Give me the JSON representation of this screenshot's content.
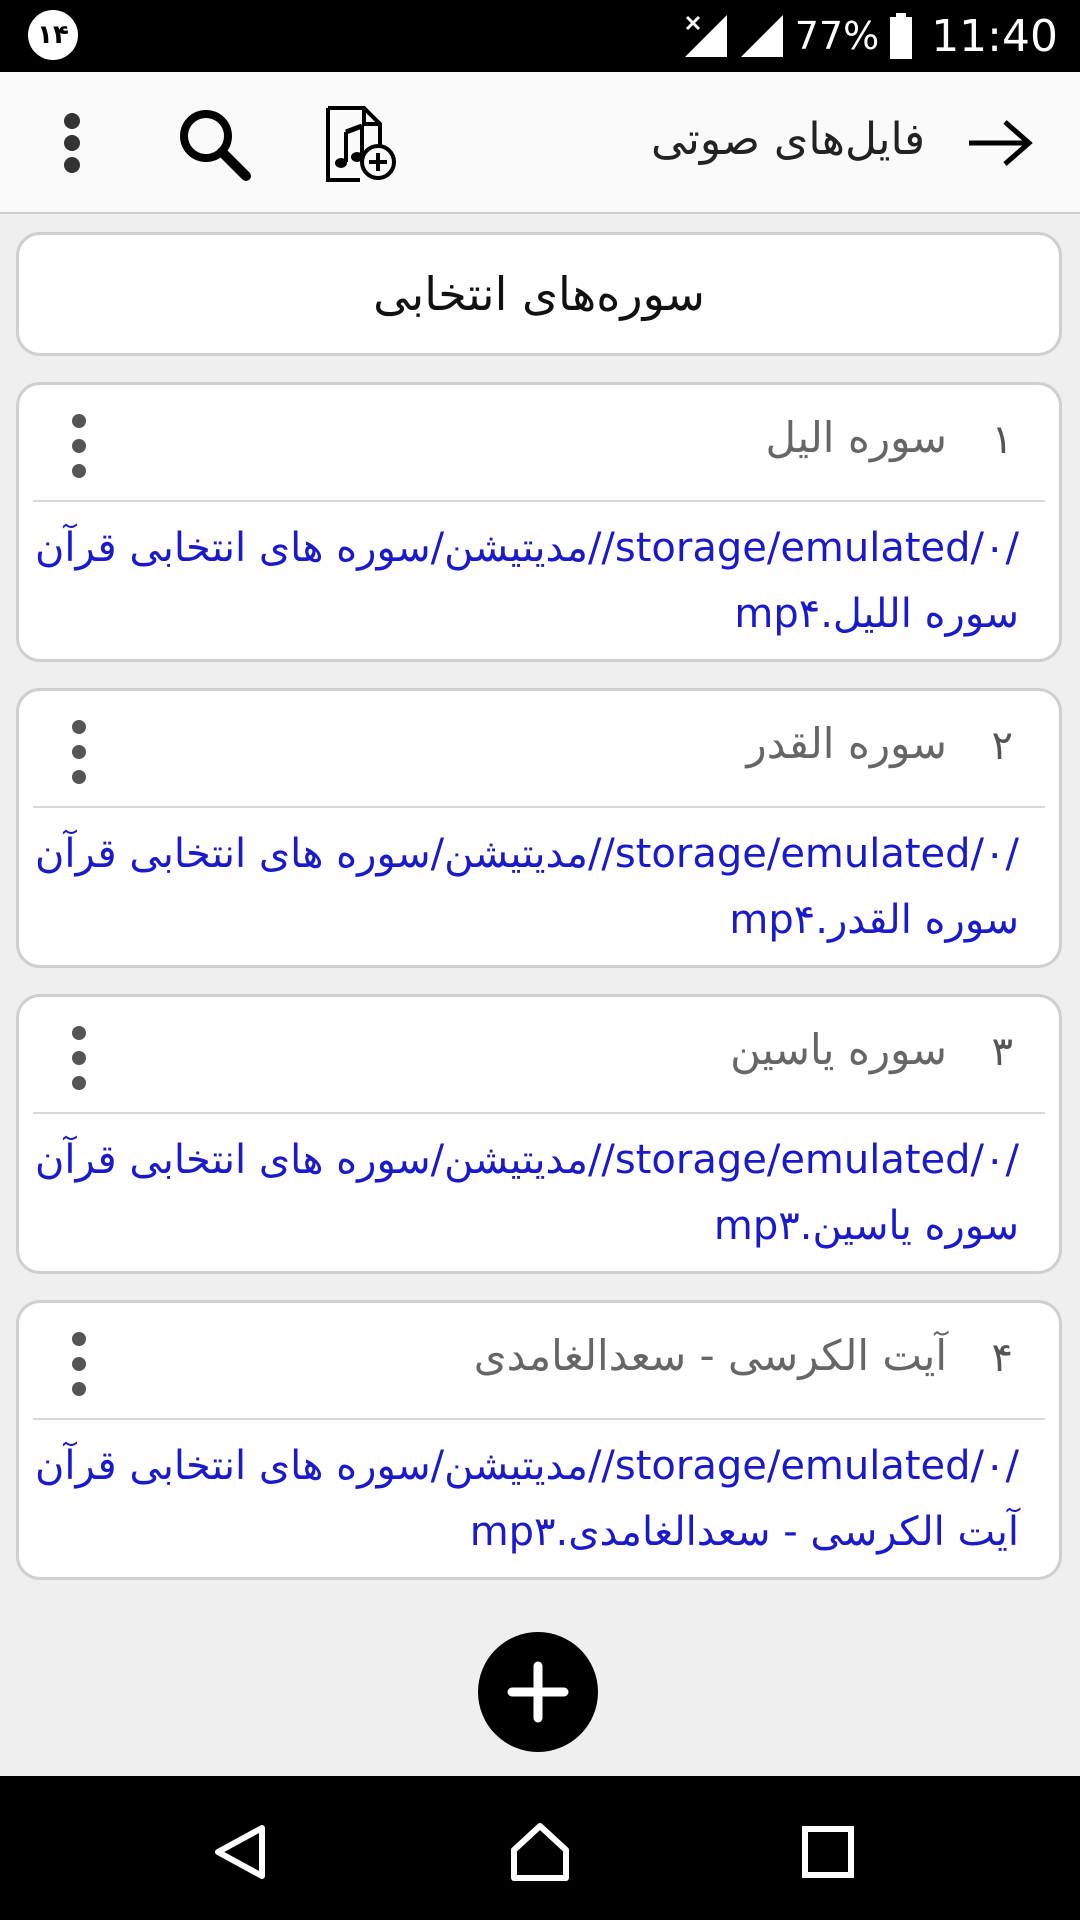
{
  "status_bar": {
    "badge": "۱۴",
    "battery": "77%",
    "time": "11:40"
  },
  "app_bar": {
    "title": "فایل‌های صوتی",
    "icons": [
      "back-arrow-icon",
      "add-audio-file-icon",
      "search-icon",
      "overflow-menu-icon"
    ]
  },
  "header": {
    "title": "سوره‌های انتخابی"
  },
  "items": [
    {
      "index": "۱",
      "title": "سوره الیل",
      "path_line1": "/storage/emulated/۰//مدیتیشن/سوره های انتخابی قرآن",
      "path_line2": "سوره اللیل.mp۴"
    },
    {
      "index": "۲",
      "title": "سوره القدر",
      "path_line1": "/storage/emulated/۰//مدیتیشن/سوره های انتخابی قرآن",
      "path_line2": "سوره القدر.mp۴"
    },
    {
      "index": "۳",
      "title": "سوره یاسین",
      "path_line1": "/storage/emulated/۰//مدیتیشن/سوره های انتخابی قرآن",
      "path_line2": "سوره یاسین.mp۳"
    },
    {
      "index": "۴",
      "title": "آیت الکرسی - سعدالغامدی",
      "path_line1": "/storage/emulated/۰//مدیتیشن/سوره های انتخابی قرآن",
      "path_line2": "آیت الکرسی - سعدالغامدی.mp۳"
    }
  ],
  "nav": {
    "icons": [
      "back-triangle-icon",
      "home-icon",
      "recents-icon"
    ]
  },
  "colors": {
    "link": "#1a1acc",
    "background": "#efefef",
    "bars": "#000000"
  }
}
